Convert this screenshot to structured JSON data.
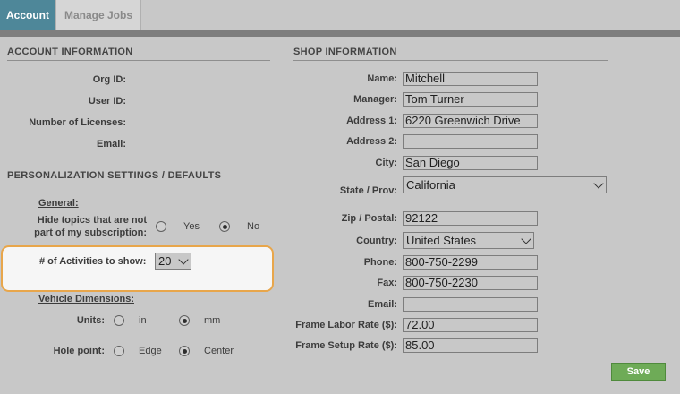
{
  "tabs": {
    "account": "Account",
    "manage_jobs": "Manage Jobs"
  },
  "account_info": {
    "title": "ACCOUNT INFORMATION",
    "org_id_label": "Org ID:",
    "user_id_label": "User ID:",
    "licenses_label": "Number of Licenses:",
    "email_label": "Email:"
  },
  "personalization": {
    "title": "PERSONALIZATION SETTINGS / DEFAULTS",
    "general_label": "General:",
    "hide_topics_line1": "Hide topics that are not",
    "hide_topics_line2": "part of my subscription:",
    "yes_label": "Yes",
    "no_label": "No",
    "hide_topics_selected": "No",
    "activities_label": "# of Activities to show:",
    "activities_value": "20",
    "vehicle_dimensions_label": "Vehicle Dimensions:",
    "units_label": "Units:",
    "units_in": "in",
    "units_mm": "mm",
    "units_selected": "mm",
    "hole_point_label": "Hole point:",
    "hole_edge": "Edge",
    "hole_center": "Center",
    "hole_selected": "Center"
  },
  "shop_info": {
    "title": "SHOP INFORMATION",
    "name_label": "Name:",
    "name_value": "Mitchell",
    "manager_label": "Manager:",
    "manager_value": "Tom Turner",
    "address1_label": "Address 1:",
    "address1_value": "6220 Greenwich Drive",
    "address2_label": "Address 2:",
    "address2_value": "",
    "city_label": "City:",
    "city_value": "San Diego",
    "state_label": "State / Prov:",
    "state_value": "California",
    "zip_label": "Zip / Postal:",
    "zip_value": "92122",
    "country_label": "Country:",
    "country_value": "United States",
    "phone_label": "Phone:",
    "phone_value": "800-750-2299",
    "fax_label": "Fax:",
    "fax_value": "800-750-2230",
    "email_label": "Email:",
    "email_value": "",
    "labor_rate_label": "Frame Labor Rate ($):",
    "labor_rate_value": "72.00",
    "setup_rate_label": "Frame Setup Rate ($):",
    "setup_rate_value": "85.00"
  },
  "save_label": "Save",
  "colors": {
    "active_tab": "#4e8799",
    "highlight_border": "#e8a64b",
    "save_button": "#6eab57"
  }
}
